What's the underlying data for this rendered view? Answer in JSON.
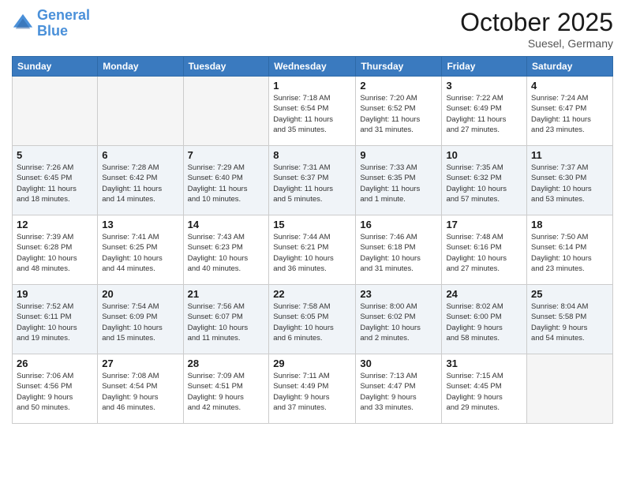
{
  "logo": {
    "line1": "General",
    "line2": "Blue"
  },
  "title": "October 2025",
  "location": "Suesel, Germany",
  "days_header": [
    "Sunday",
    "Monday",
    "Tuesday",
    "Wednesday",
    "Thursday",
    "Friday",
    "Saturday"
  ],
  "weeks": [
    {
      "shaded": false,
      "days": [
        {
          "num": "",
          "info": ""
        },
        {
          "num": "",
          "info": ""
        },
        {
          "num": "",
          "info": ""
        },
        {
          "num": "1",
          "info": "Sunrise: 7:18 AM\nSunset: 6:54 PM\nDaylight: 11 hours\nand 35 minutes."
        },
        {
          "num": "2",
          "info": "Sunrise: 7:20 AM\nSunset: 6:52 PM\nDaylight: 11 hours\nand 31 minutes."
        },
        {
          "num": "3",
          "info": "Sunrise: 7:22 AM\nSunset: 6:49 PM\nDaylight: 11 hours\nand 27 minutes."
        },
        {
          "num": "4",
          "info": "Sunrise: 7:24 AM\nSunset: 6:47 PM\nDaylight: 11 hours\nand 23 minutes."
        }
      ]
    },
    {
      "shaded": true,
      "days": [
        {
          "num": "5",
          "info": "Sunrise: 7:26 AM\nSunset: 6:45 PM\nDaylight: 11 hours\nand 18 minutes."
        },
        {
          "num": "6",
          "info": "Sunrise: 7:28 AM\nSunset: 6:42 PM\nDaylight: 11 hours\nand 14 minutes."
        },
        {
          "num": "7",
          "info": "Sunrise: 7:29 AM\nSunset: 6:40 PM\nDaylight: 11 hours\nand 10 minutes."
        },
        {
          "num": "8",
          "info": "Sunrise: 7:31 AM\nSunset: 6:37 PM\nDaylight: 11 hours\nand 5 minutes."
        },
        {
          "num": "9",
          "info": "Sunrise: 7:33 AM\nSunset: 6:35 PM\nDaylight: 11 hours\nand 1 minute."
        },
        {
          "num": "10",
          "info": "Sunrise: 7:35 AM\nSunset: 6:32 PM\nDaylight: 10 hours\nand 57 minutes."
        },
        {
          "num": "11",
          "info": "Sunrise: 7:37 AM\nSunset: 6:30 PM\nDaylight: 10 hours\nand 53 minutes."
        }
      ]
    },
    {
      "shaded": false,
      "days": [
        {
          "num": "12",
          "info": "Sunrise: 7:39 AM\nSunset: 6:28 PM\nDaylight: 10 hours\nand 48 minutes."
        },
        {
          "num": "13",
          "info": "Sunrise: 7:41 AM\nSunset: 6:25 PM\nDaylight: 10 hours\nand 44 minutes."
        },
        {
          "num": "14",
          "info": "Sunrise: 7:43 AM\nSunset: 6:23 PM\nDaylight: 10 hours\nand 40 minutes."
        },
        {
          "num": "15",
          "info": "Sunrise: 7:44 AM\nSunset: 6:21 PM\nDaylight: 10 hours\nand 36 minutes."
        },
        {
          "num": "16",
          "info": "Sunrise: 7:46 AM\nSunset: 6:18 PM\nDaylight: 10 hours\nand 31 minutes."
        },
        {
          "num": "17",
          "info": "Sunrise: 7:48 AM\nSunset: 6:16 PM\nDaylight: 10 hours\nand 27 minutes."
        },
        {
          "num": "18",
          "info": "Sunrise: 7:50 AM\nSunset: 6:14 PM\nDaylight: 10 hours\nand 23 minutes."
        }
      ]
    },
    {
      "shaded": true,
      "days": [
        {
          "num": "19",
          "info": "Sunrise: 7:52 AM\nSunset: 6:11 PM\nDaylight: 10 hours\nand 19 minutes."
        },
        {
          "num": "20",
          "info": "Sunrise: 7:54 AM\nSunset: 6:09 PM\nDaylight: 10 hours\nand 15 minutes."
        },
        {
          "num": "21",
          "info": "Sunrise: 7:56 AM\nSunset: 6:07 PM\nDaylight: 10 hours\nand 11 minutes."
        },
        {
          "num": "22",
          "info": "Sunrise: 7:58 AM\nSunset: 6:05 PM\nDaylight: 10 hours\nand 6 minutes."
        },
        {
          "num": "23",
          "info": "Sunrise: 8:00 AM\nSunset: 6:02 PM\nDaylight: 10 hours\nand 2 minutes."
        },
        {
          "num": "24",
          "info": "Sunrise: 8:02 AM\nSunset: 6:00 PM\nDaylight: 9 hours\nand 58 minutes."
        },
        {
          "num": "25",
          "info": "Sunrise: 8:04 AM\nSunset: 5:58 PM\nDaylight: 9 hours\nand 54 minutes."
        }
      ]
    },
    {
      "shaded": false,
      "days": [
        {
          "num": "26",
          "info": "Sunrise: 7:06 AM\nSunset: 4:56 PM\nDaylight: 9 hours\nand 50 minutes."
        },
        {
          "num": "27",
          "info": "Sunrise: 7:08 AM\nSunset: 4:54 PM\nDaylight: 9 hours\nand 46 minutes."
        },
        {
          "num": "28",
          "info": "Sunrise: 7:09 AM\nSunset: 4:51 PM\nDaylight: 9 hours\nand 42 minutes."
        },
        {
          "num": "29",
          "info": "Sunrise: 7:11 AM\nSunset: 4:49 PM\nDaylight: 9 hours\nand 37 minutes."
        },
        {
          "num": "30",
          "info": "Sunrise: 7:13 AM\nSunset: 4:47 PM\nDaylight: 9 hours\nand 33 minutes."
        },
        {
          "num": "31",
          "info": "Sunrise: 7:15 AM\nSunset: 4:45 PM\nDaylight: 9 hours\nand 29 minutes."
        },
        {
          "num": "",
          "info": ""
        }
      ]
    }
  ]
}
